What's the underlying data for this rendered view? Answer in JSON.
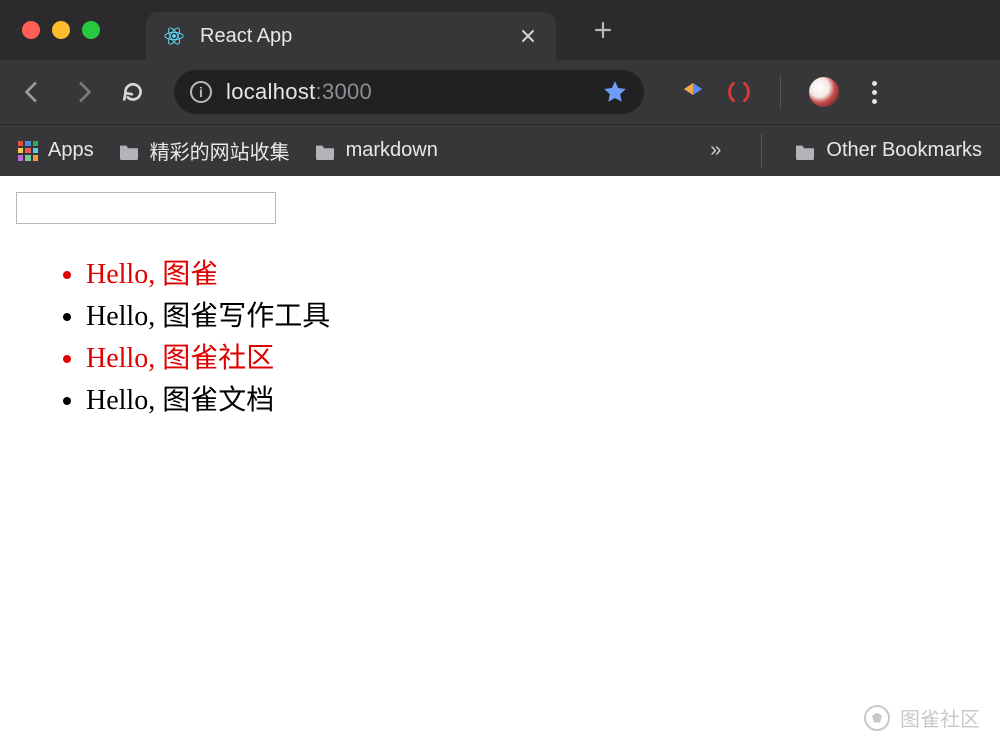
{
  "window": {
    "tab": {
      "title": "React App",
      "icon": "react-icon"
    }
  },
  "toolbar": {
    "url_host": "localhost",
    "url_port": ":3000"
  },
  "bookmarks": {
    "apps_label": "Apps",
    "folders": [
      "精彩的网站收集",
      "markdown"
    ],
    "other_label": "Other Bookmarks"
  },
  "page": {
    "input_value": "",
    "items": [
      {
        "text": "Hello, 图雀",
        "red": true
      },
      {
        "text": "Hello, 图雀写作工具",
        "red": false
      },
      {
        "text": "Hello, 图雀社区",
        "red": true
      },
      {
        "text": "Hello, 图雀文档",
        "red": false
      }
    ]
  },
  "watermark": {
    "label": "图雀社区"
  }
}
